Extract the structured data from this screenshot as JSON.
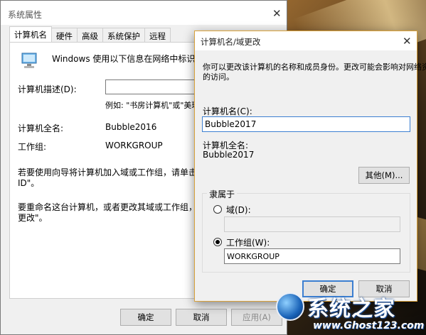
{
  "back_window": {
    "title": "系统属性",
    "tabs": [
      "计算机名",
      "硬件",
      "高级",
      "系统保护",
      "远程"
    ],
    "description_text": "Windows 使用以下信息在网络中标识这台计",
    "computer_desc_label": "计算机描述(D):",
    "computer_desc_value": "",
    "example_text": "例如: \"书房计算机\"或\"美玲的",
    "full_name_label": "计算机全名:",
    "full_name_value": "Bubble2016",
    "workgroup_label": "工作组:",
    "workgroup_value": "WORKGROUP",
    "wizard_line1": "若要使用向导将计算机加入域或工作组，请单击\"网络",
    "wizard_line2": "ID\"。",
    "rename_line1": "要重命名这台计算机，或者更改其域或工作组，请单击\"",
    "rename_line2": "更改\"。",
    "ok_label": "确定",
    "cancel_label": "取消",
    "apply_label": "应用(A)"
  },
  "dialog": {
    "title": "计算机名/域更改",
    "intro_line1": "你可以更改该计算机的名称和成员身份。更改可能会影响对网络资源",
    "intro_line2": "的访问。",
    "computer_name_label": "计算机名(C):",
    "computer_name_value": "Bubble2017",
    "full_name_label": "计算机全名:",
    "full_name_value": "Bubble2017",
    "more_button": "其他(M)...",
    "member_of_label": "隶属于",
    "domain_label": "域(D):",
    "domain_value": "",
    "workgroup_label": "工作组(W):",
    "workgroup_value": "WORKGROUP",
    "ok_label": "确定",
    "cancel_label": "取消"
  },
  "watermark": {
    "text": "系统之家",
    "url": "www.Ghost123.com"
  }
}
